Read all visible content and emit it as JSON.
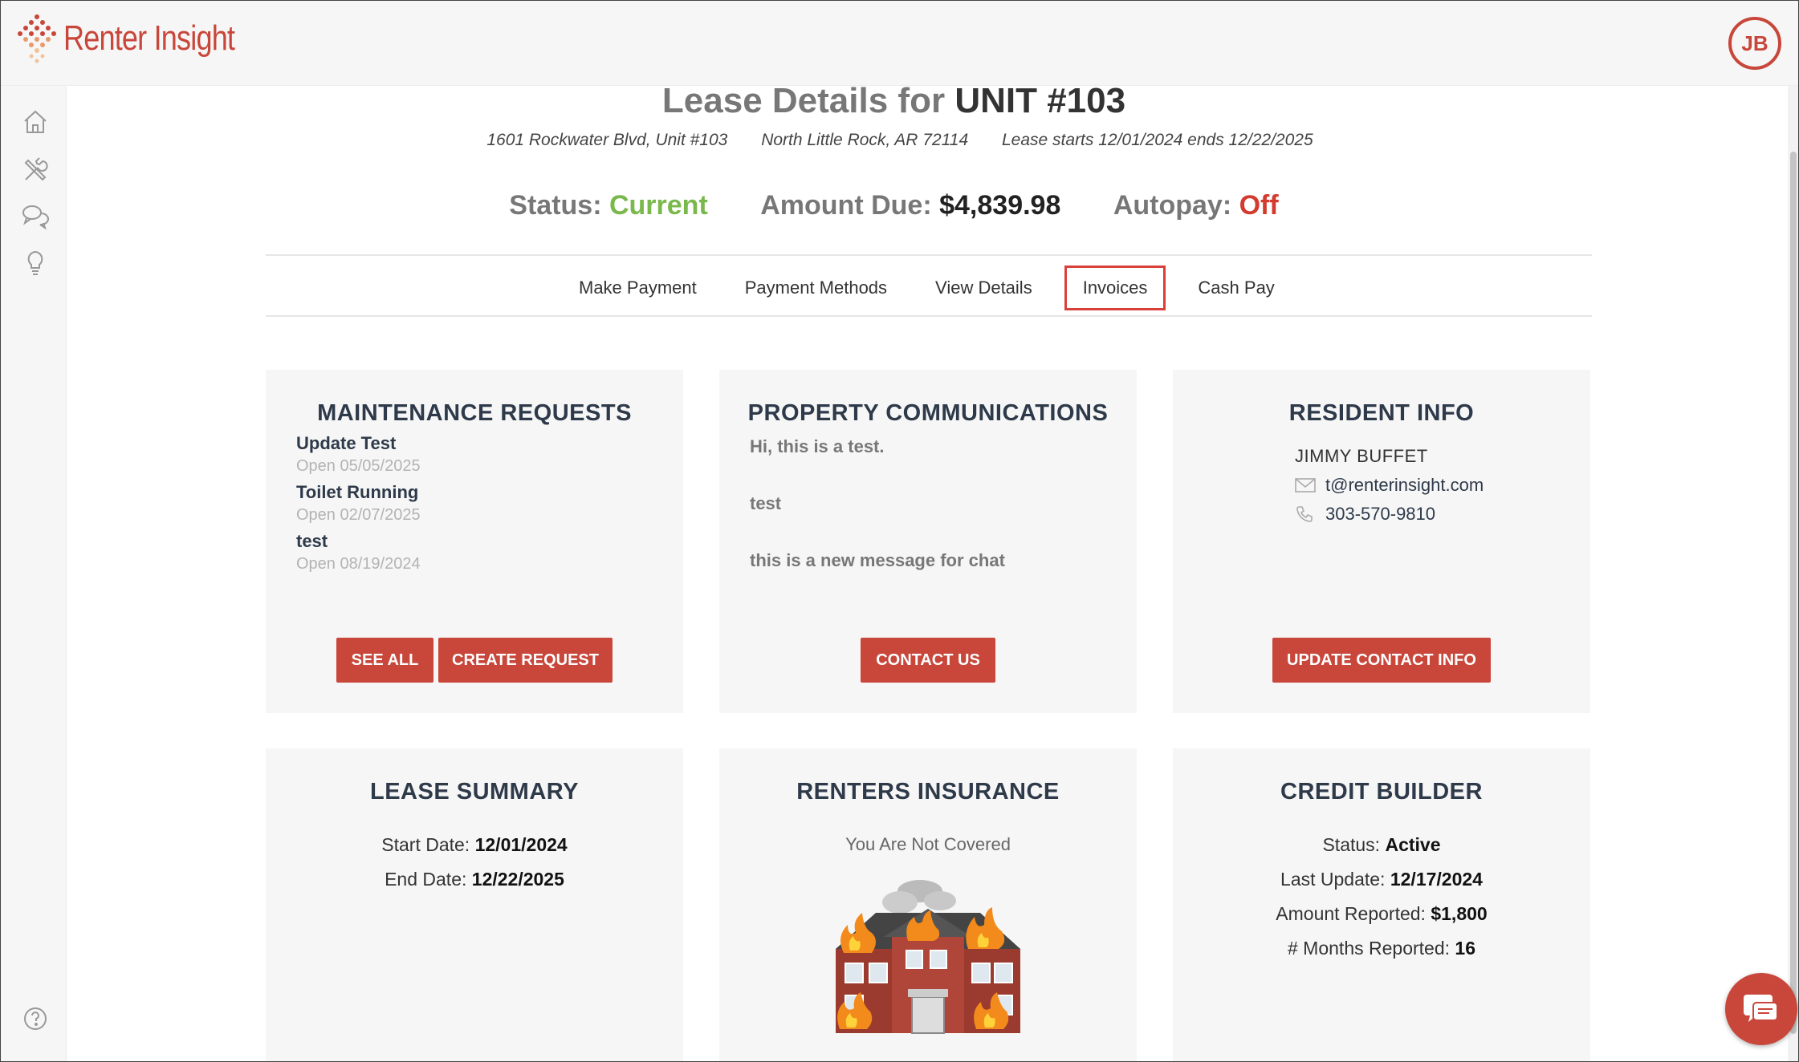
{
  "app": {
    "logo_text": "Renter Insight",
    "avatar_initials": "JB",
    "brand_color": "#c8463a"
  },
  "sidebar": {
    "items": [
      {
        "icon": "home-icon"
      },
      {
        "icon": "tools-icon"
      },
      {
        "icon": "chat-icon"
      },
      {
        "icon": "lightbulb-icon"
      },
      {
        "icon": "help-icon"
      }
    ]
  },
  "header": {
    "title_prefix": "Lease Details for",
    "title_unit": "UNIT #103",
    "address": "1601 Rockwater Blvd, Unit #103",
    "city": "North Little Rock, AR 72114",
    "lease_period": "Lease starts 12/01/2024 ends 12/22/2025"
  },
  "status": {
    "status_label": "Status:",
    "status_value": "Current",
    "amount_label": "Amount Due:",
    "amount_value": "$4,839.98",
    "autopay_label": "Autopay:",
    "autopay_value": "Off",
    "colors": {
      "current": "#79b84a",
      "off": "#d23b2e"
    }
  },
  "tabs": [
    {
      "label": "Make Payment",
      "active": false
    },
    {
      "label": "Payment Methods",
      "active": false
    },
    {
      "label": "View Details",
      "active": false
    },
    {
      "label": "Invoices",
      "active": true
    },
    {
      "label": "Cash Pay",
      "active": false
    }
  ],
  "maintenance": {
    "title": "MAINTENANCE REQUESTS",
    "items": [
      {
        "title": "Update Test",
        "status": "Open 05/05/2025"
      },
      {
        "title": "Toilet Running",
        "status": "Open 02/07/2025"
      },
      {
        "title": "test",
        "status": "Open 08/19/2024"
      }
    ],
    "see_all_label": "SEE ALL",
    "create_label": "CREATE REQUEST"
  },
  "communications": {
    "title": "PROPERTY COMMUNICATIONS",
    "items": [
      "Hi, this is a test.",
      "test",
      "this is a new message for chat"
    ],
    "contact_label": "CONTACT US"
  },
  "resident": {
    "title": "RESIDENT INFO",
    "name": "JIMMY BUFFET",
    "email": "t@renterinsight.com",
    "phone": "303-570-9810",
    "update_label": "UPDATE CONTACT INFO"
  },
  "lease_summary": {
    "title": "LEASE SUMMARY",
    "start_label": "Start Date:",
    "start_value": "12/01/2024",
    "end_label": "End Date:",
    "end_value": "12/22/2025"
  },
  "insurance": {
    "title": "RENTERS INSURANCE",
    "status_text": "You Are Not Covered"
  },
  "credit_builder": {
    "title": "CREDIT BUILDER",
    "status_label": "Status:",
    "status_value": "Active",
    "last_update_label": "Last Update:",
    "last_update_value": "12/17/2024",
    "amount_label": "Amount Reported:",
    "amount_value": "$1,800",
    "months_label": "# Months Reported:",
    "months_value": "16"
  }
}
